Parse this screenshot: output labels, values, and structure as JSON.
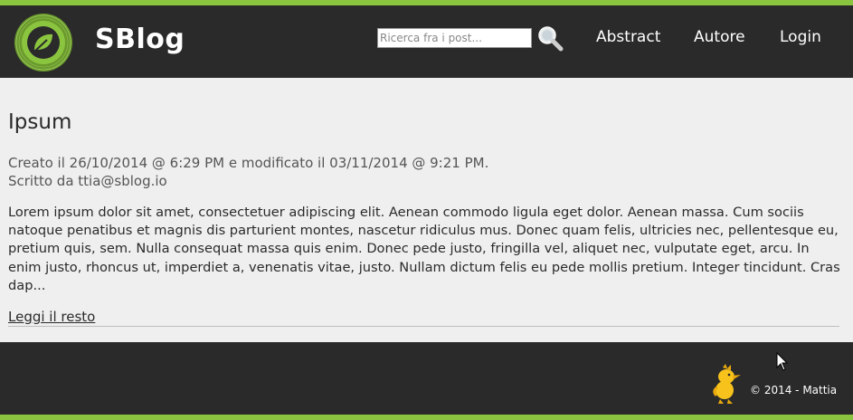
{
  "header": {
    "brand": "SBlog",
    "search_placeholder": "Ricerca fra i post...",
    "nav": {
      "abstract": "Abstract",
      "author": "Autore",
      "login": "Login"
    }
  },
  "post": {
    "title": "Ipsum",
    "meta_line": "Creato il 26/10/2014 @ 6:29 PM e modificato il 03/11/2014 @ 9:21 PM.",
    "author_line": "Scritto da ttia@sblog.io",
    "excerpt": "Lorem ipsum dolor sit amet, consectetuer adipiscing elit. Aenean commodo ligula eget dolor. Aenean massa. Cum sociis natoque penatibus et magnis dis parturient montes, nascetur ridiculus mus. Donec quam felis, ultricies nec, pellentesque eu, pretium quis, sem. Nulla consequat massa quis enim. Donec pede justo, fringilla vel, aliquet nec, vulputate eget, arcu. In enim justo, rhoncus ut, imperdiet a, venenatis vitae, justo. Nullam dictum felis eu pede mollis pretium. Integer tincidunt. Cras dap...",
    "read_more": "Leggi il resto"
  },
  "footer": {
    "copyright": "© 2014 - Mattia"
  },
  "icons": {
    "logo": "leaf-logo-icon",
    "search": "magnifier-icon",
    "mascot": "bird-mascot-icon",
    "cursor": "mouse-pointer-icon"
  },
  "colors": {
    "accent": "#8bc53f",
    "bar": "#2a2a2b",
    "background": "#efefef"
  }
}
